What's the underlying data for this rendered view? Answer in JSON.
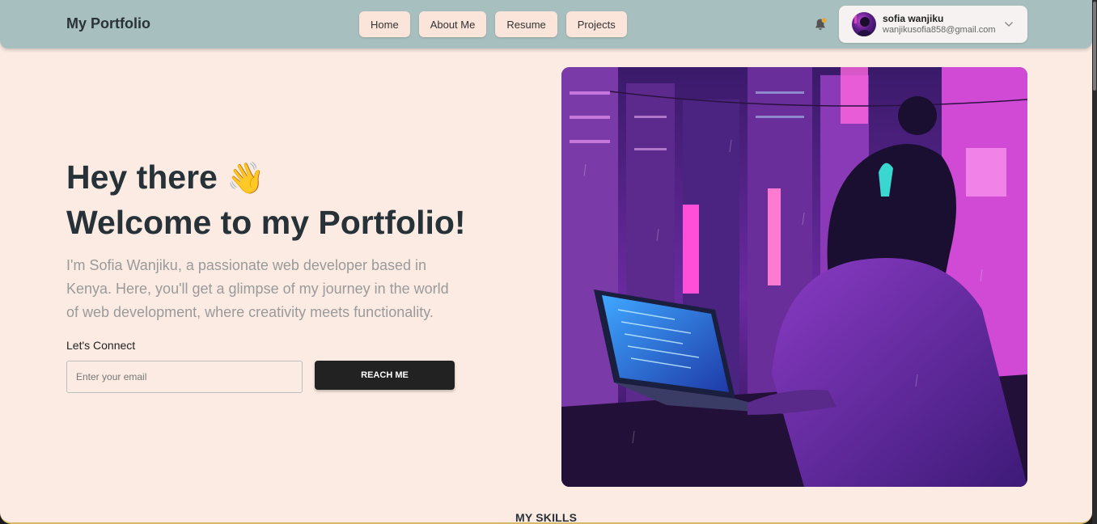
{
  "header": {
    "brand": "My Portfolio",
    "nav": [
      {
        "label": "Home"
      },
      {
        "label": "About Me"
      },
      {
        "label": "Resume"
      },
      {
        "label": "Projects"
      }
    ],
    "notification_icon": "bell-icon",
    "user": {
      "name": "sofia wanjiku",
      "email": "wanjikusofia858@gmail.com",
      "dropdown_icon": "chevron-down-icon"
    }
  },
  "hero": {
    "greeting": "Hey there",
    "wave_emoji": "👋",
    "title": "Welcome to my Portfolio!",
    "description": "I'm Sofia Wanjiku, a passionate web developer based in Kenya. Here, you'll get a glimpse of my journey in the world of web development, where creativity meets functionality.",
    "connect_label": "Let's Connect",
    "email_placeholder": "Enter your email",
    "reach_button": "REACH ME"
  },
  "skills": {
    "heading": "MY SKILLS"
  },
  "colors": {
    "header_bg": "#a7bfbe",
    "page_bg": "#fbebe3",
    "nav_button_bg": "#fbe4da",
    "primary_button": "#222222",
    "heading_text": "#273238",
    "muted_text": "#9a9a9a"
  }
}
